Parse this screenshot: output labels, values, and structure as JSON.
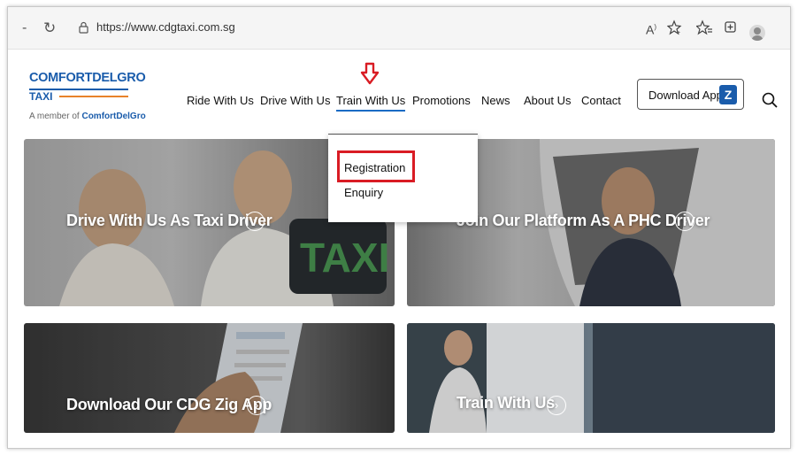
{
  "browser": {
    "back": "-",
    "refresh": "↻",
    "url": "https://www.cdgtaxi.com.sg",
    "icons": [
      "read-aloud-icon",
      "favorite-add-icon",
      "favorites-icon",
      "collections-icon",
      "profile-icon"
    ]
  },
  "logo": {
    "brand": "COMFORTDELGRO",
    "taxi": "TAXI",
    "member_prefix": "A member of ",
    "member_brand": "ComfortDelGro"
  },
  "nav": {
    "items": [
      "Ride With Us",
      "Drive With Us",
      "Train With Us",
      "Promotions",
      "News",
      "About Us",
      "Contact"
    ],
    "active": "Train With Us",
    "download_label": "Download App",
    "download_icon_letter": "Z"
  },
  "dropdown": {
    "items": [
      "Registration",
      "Enquiry"
    ],
    "highlighted": "Registration",
    "highlight_color": "#d91c24"
  },
  "cards": [
    {
      "label": "Drive With Us As Taxi Driver"
    },
    {
      "label": "Join Our Platform As A PHC Driver"
    },
    {
      "label": "Download Our CDG Zig App"
    },
    {
      "label": "Train With Us"
    }
  ],
  "colors": {
    "brand_blue": "#1a5cab",
    "brand_orange": "#e8822a",
    "active_underline": "#1a6bc4",
    "annotation_red": "#d91c24"
  }
}
